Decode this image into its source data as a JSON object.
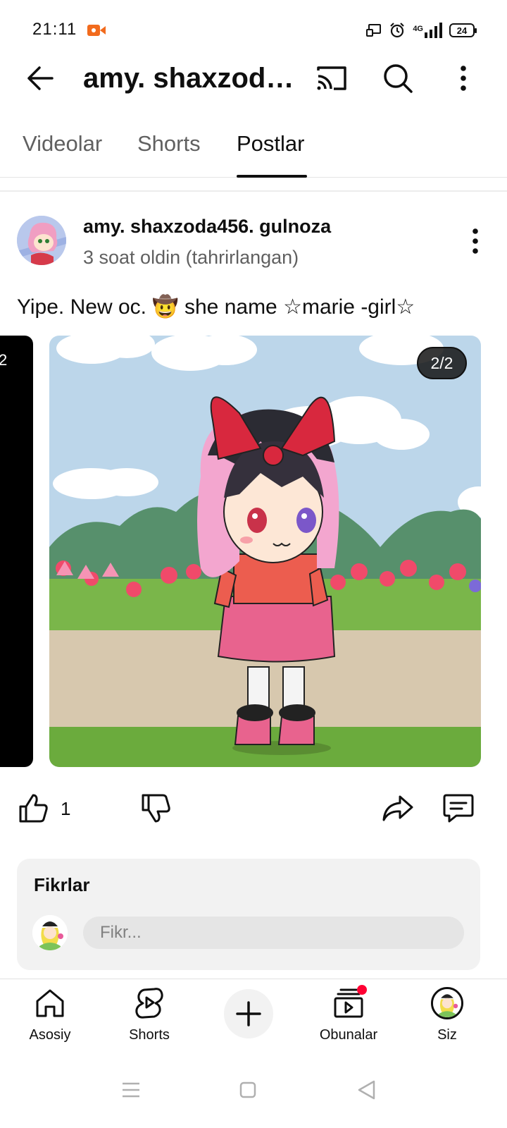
{
  "status_bar": {
    "time": "21:11",
    "network": "4G",
    "battery": "24",
    "icons": [
      "screen-record-icon",
      "cast-status-icon",
      "alarm-icon",
      "signal-icon",
      "battery-icon"
    ]
  },
  "app_bar": {
    "title": "amy.  shaxzod…",
    "icons": [
      "back-arrow-icon",
      "cast-icon",
      "search-icon",
      "more-vertical-icon"
    ]
  },
  "tabs": [
    {
      "label": "Videolar",
      "active": false
    },
    {
      "label": "Shorts",
      "active": false
    },
    {
      "label": "Postlar",
      "active": true
    }
  ],
  "post": {
    "author": "amy.  shaxzoda456.  gulnoza",
    "timestamp": "3 soat oldin (tahrirlangan)",
    "text": "Yipe.  New oc.  🤠 she name  ☆marie -girl☆",
    "prev_counter": "2",
    "image_counter": "2/2",
    "like_count": "1"
  },
  "comments": {
    "title": "Fikrlar",
    "placeholder": "Fikr..."
  },
  "bottom_nav": {
    "items": [
      {
        "label": "Asosiy",
        "icon": "home-icon"
      },
      {
        "label": "Shorts",
        "icon": "shorts-icon"
      },
      {
        "label": "",
        "icon": "plus-icon"
      },
      {
        "label": "Obunalar",
        "icon": "subscriptions-icon"
      },
      {
        "label": "Siz",
        "icon": "avatar"
      }
    ]
  },
  "colors": {
    "accent_red": "#ff0033",
    "text_primary": "#0f0f0f",
    "text_secondary": "#606060",
    "record_orange": "#f26b1d"
  }
}
